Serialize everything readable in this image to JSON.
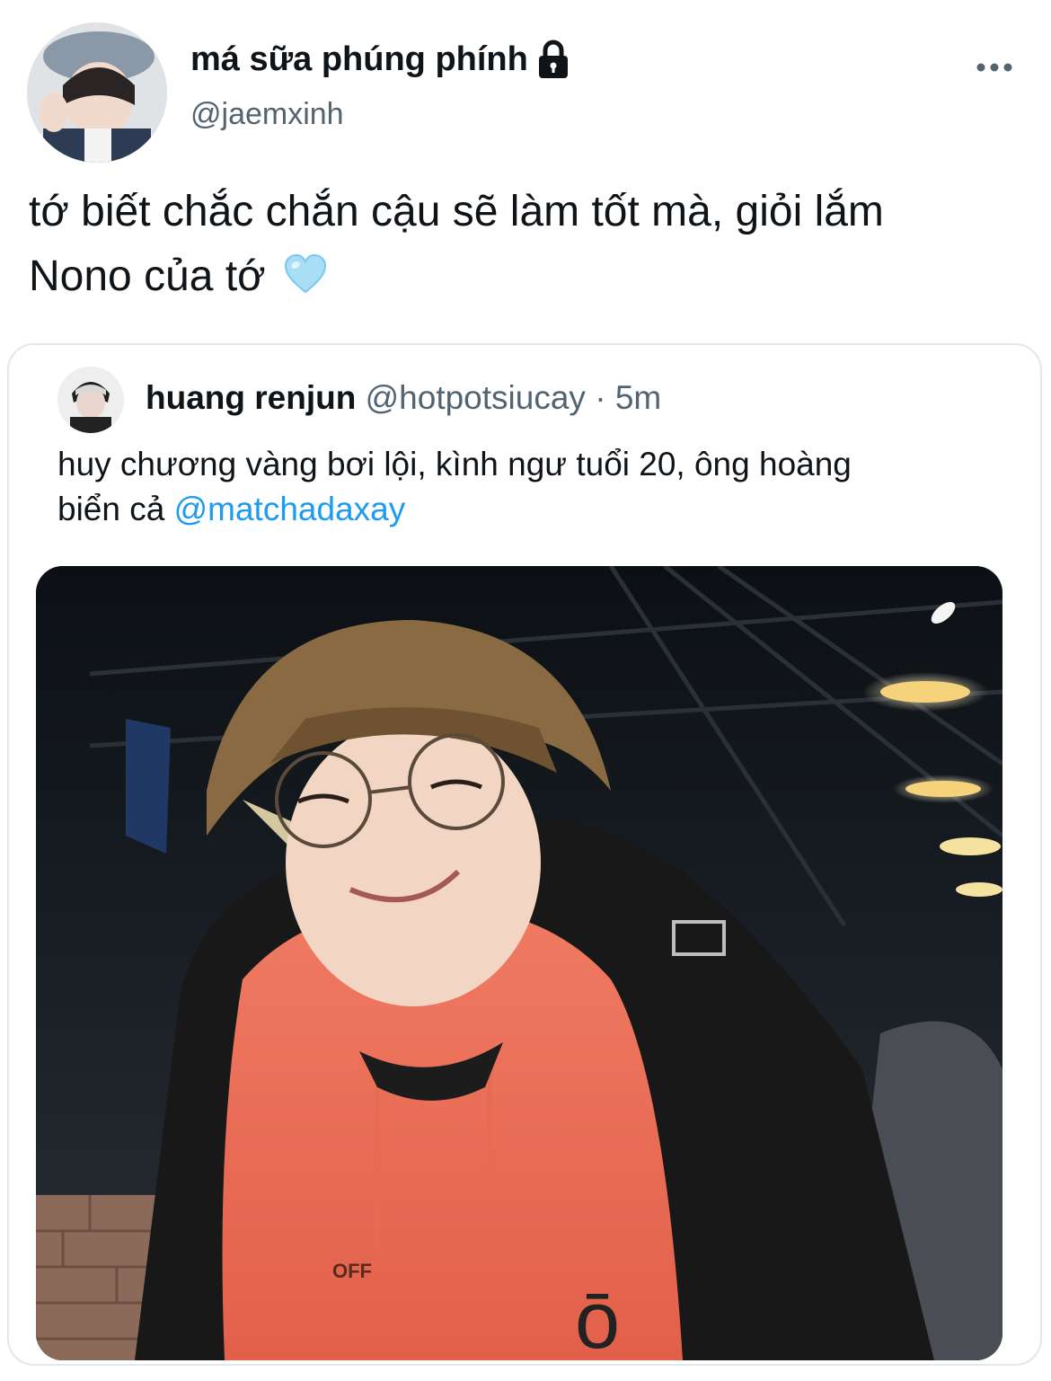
{
  "tweet": {
    "author": {
      "display_name": "má sữa phúng phính",
      "handle": "@jaemxinh",
      "protected_icon": "lock-icon"
    },
    "more_icon": "more-horizontal-icon",
    "text_line1": "tớ biết chắc chắn cậu sẽ làm tốt mà, giỏi lắm",
    "text_line2": "Nono của tớ",
    "emoji": "light-blue-heart-icon"
  },
  "quote": {
    "author": {
      "display_name": "huang renjun",
      "handle": "@hotpotsiucay",
      "separator": "·",
      "time": "5m"
    },
    "text_line1": "huy chương vàng bơi lội, kình ngư tuổi 20, ông hoàng",
    "text_line2_prefix": "biển cả",
    "mention": "@matchadaxay",
    "media_print_1": "OFF",
    "media_print_2": "ō"
  },
  "colors": {
    "text": "#0f1419",
    "secondary": "#536471",
    "link": "#1d9bf0",
    "border": "#e4e8eb",
    "hoodie": "#e8705a",
    "heart": "#8fd3f5"
  }
}
